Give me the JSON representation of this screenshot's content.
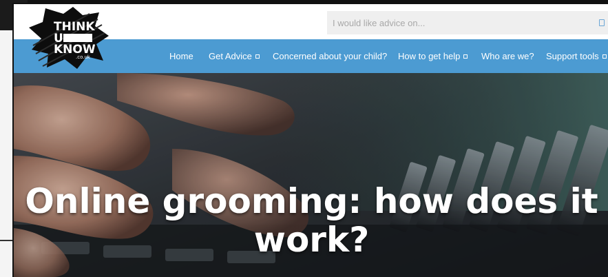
{
  "logo": {
    "line1": "THINK",
    "line2": "U",
    "line3": "KNOW",
    "domain": ".co.uk"
  },
  "search": {
    "placeholder": "I would like advice on..."
  },
  "nav": {
    "items": [
      {
        "label": "Home",
        "has_dropdown": false
      },
      {
        "label": "Get Advice",
        "has_dropdown": true
      },
      {
        "label": "Concerned about your child?",
        "has_dropdown": false
      },
      {
        "label": "How to get help",
        "has_dropdown": true
      },
      {
        "label": "Who are we?",
        "has_dropdown": false
      },
      {
        "label": "Support tools",
        "has_dropdown": true
      }
    ]
  },
  "hero": {
    "title": "Online grooming: how does it work?"
  },
  "colors": {
    "nav_background": "#4c9bd2",
    "search_background": "#efefef",
    "search_icon": "#6aa6d6",
    "hero_text": "#ffffff"
  },
  "icons": [
    "search-icon",
    "dropdown-caret-icon"
  ]
}
